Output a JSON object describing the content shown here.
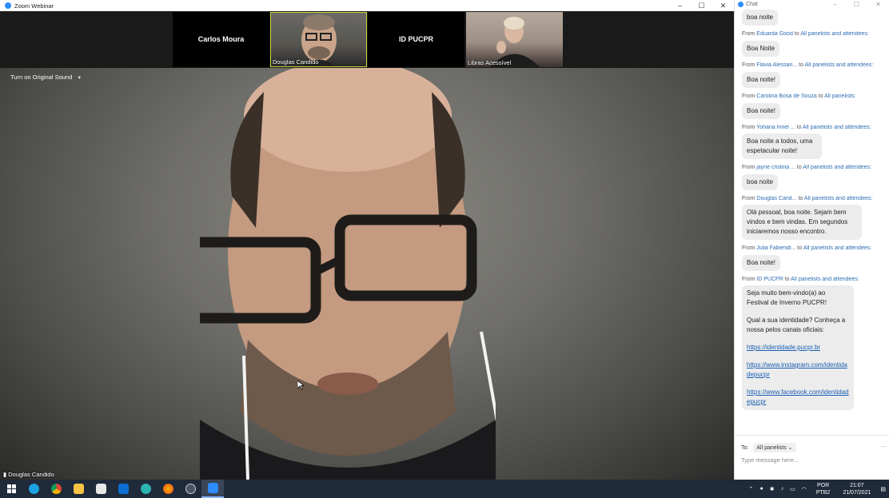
{
  "window": {
    "title": "Zoom Webinar",
    "controls": [
      "–",
      "☐",
      "✕"
    ]
  },
  "thumbnails": [
    {
      "type": "name",
      "name": "Carlos Moura"
    },
    {
      "type": "video",
      "label": "Douglas Candido"
    },
    {
      "type": "name",
      "name": "ID PUCPR"
    },
    {
      "type": "video",
      "label": "Libras Acessível"
    }
  ],
  "speaker": {
    "sound_dropdown": "Turn on Original Sound",
    "name": "Douglas Candido"
  },
  "chat": {
    "title": "Chat",
    "messages": [
      {
        "from": "",
        "to": "",
        "lines": [
          "boa noite"
        ]
      },
      {
        "from": "Eduarda Good",
        "to": "All panelists and attendees:",
        "lines": [
          "Boa Noite"
        ]
      },
      {
        "from": "Flávia Alessan...",
        "to": "All panelists and attendees:",
        "lines": [
          "Boa noite!"
        ]
      },
      {
        "from": "Carolina Bosa de Souza",
        "to": "All panelists:",
        "lines": [
          "Boa noite!"
        ]
      },
      {
        "from": "Yohana Irinel ...",
        "to": "All panelists and attendees:",
        "lines": [
          "Boa noite a todos, uma espetacular noite!"
        ]
      },
      {
        "from": "jayne cristina ...",
        "to": "All panelists and attendees:",
        "lines": [
          "boa noite"
        ]
      },
      {
        "from": "Douglas Cand...",
        "to": "All panelists and attendees:",
        "lines": [
          "Olá pessoal, boa noite. Sejam bem vindos e bem vindas. Em segundos iniciaremos nosso encontro."
        ]
      },
      {
        "from": "Julia Fabiendi...",
        "to": "All panelists and attendees:",
        "lines": [
          "Boa noite!"
        ]
      },
      {
        "from": "ID PUCPR",
        "to": "All panelists and attendees:",
        "lines": [
          "Seja muito bem-vindo(a) ao Festival de Inverno PUCPR!",
          "Qual a sua identidade? Conheça a nossa pelos canais oficiais:"
        ],
        "links": [
          "https://identidade.pucpr.br",
          "https://www.instagram.com/identidadepucpr",
          "https://www.facebook.com/identidadepucpr"
        ]
      }
    ],
    "from_word": "From",
    "to_word": "to",
    "to_label": "To:",
    "to_select": "All panelists",
    "more": "···",
    "input_placeholder": "Type message here..."
  },
  "taskbar": {
    "icons": [
      "windows-start-icon",
      "edge-icon",
      "chrome-icon",
      "file-explorer-icon",
      "store-icon",
      "mail-icon",
      "app-icon",
      "firefox-icon",
      "clock-app-icon",
      "zoom-icon"
    ],
    "lang_line1": "POR",
    "lang_line2": "PTB2",
    "time": "21:07",
    "date": "21/07/2021"
  }
}
